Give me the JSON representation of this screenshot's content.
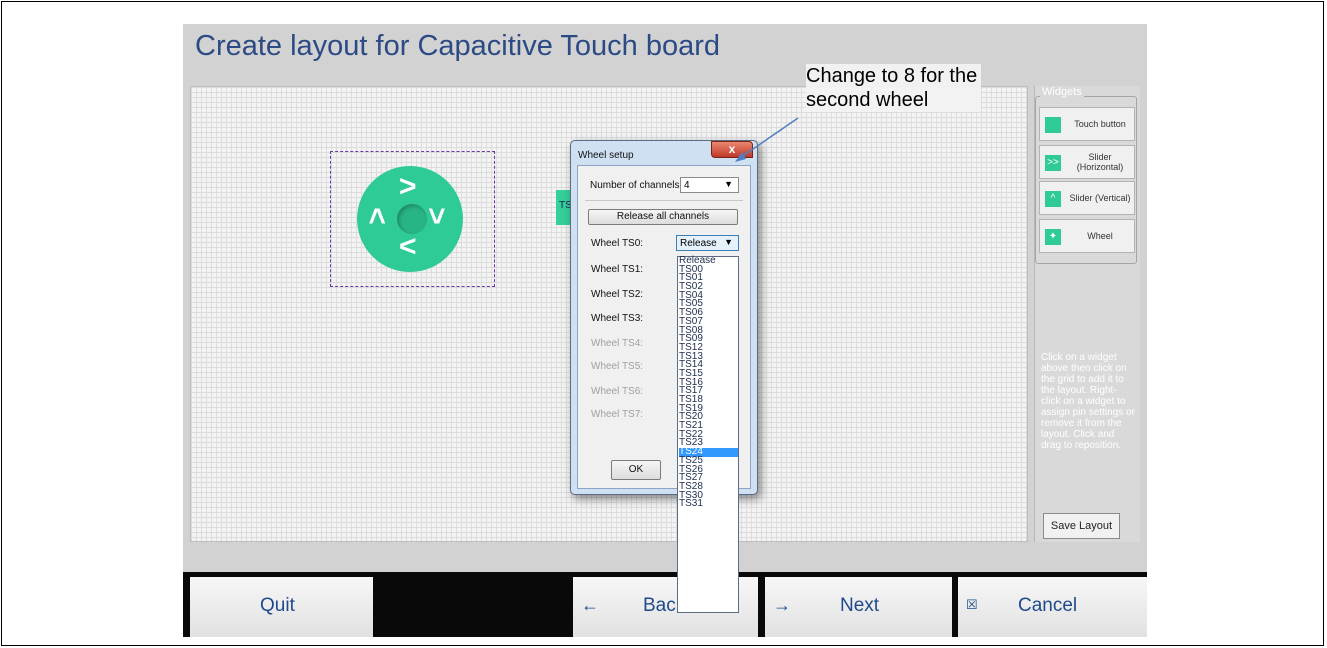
{
  "app": {
    "title": "Create layout for Capacitive Touch board"
  },
  "annotation": {
    "line1": "Change to 8 for the",
    "line2": "second wheel"
  },
  "canvas": {
    "chip_label": "TS"
  },
  "widgets": {
    "heading": "Widgets",
    "items": [
      {
        "label": "Touch button",
        "icon": "square-swatch-icon"
      },
      {
        "label": "Slider (Horizontal)",
        "icon": "horizontal-slider-icon"
      },
      {
        "label": "Slider (Vertical)",
        "icon": "vertical-slider-icon"
      },
      {
        "label": "Wheel",
        "icon": "wheel-icon"
      }
    ],
    "help": "Click on a widget above then click on the grid to add it to the layout. Right-click on a widget to assign pin settings or remove it from the layout. Click and drag to reposition.",
    "save_label": "Save Layout"
  },
  "footer": {
    "quit": "Quit",
    "back": "Back",
    "next": "Next",
    "cancel": "Cancel"
  },
  "dialog": {
    "title": "Wheel setup",
    "close": "x",
    "channels_label": "Number of channels",
    "channels_value": "4",
    "release_all": "Release all channels",
    "rows": [
      {
        "label": "Wheel TS0:",
        "enabled": true
      },
      {
        "label": "Wheel TS1:",
        "enabled": true
      },
      {
        "label": "Wheel TS2:",
        "enabled": true
      },
      {
        "label": "Wheel TS3:",
        "enabled": true
      },
      {
        "label": "Wheel TS4:",
        "enabled": false
      },
      {
        "label": "Wheel TS5:",
        "enabled": false
      },
      {
        "label": "Wheel TS6:",
        "enabled": false
      },
      {
        "label": "Wheel TS7:",
        "enabled": false
      }
    ],
    "ts0_value": "Release",
    "ok": "OK",
    "dropdown_options": [
      "Release",
      "TS00",
      "TS01",
      "TS02",
      "TS04",
      "TS05",
      "TS06",
      "TS07",
      "TS08",
      "TS09",
      "TS12",
      "TS13",
      "TS14",
      "TS15",
      "TS16",
      "TS17",
      "TS18",
      "TS19",
      "TS20",
      "TS21",
      "TS22",
      "TS23",
      "TS24",
      "TS25",
      "TS26",
      "TS27",
      "TS28",
      "TS30",
      "TS31"
    ],
    "dropdown_selected": "TS24"
  },
  "colors": {
    "accent": "#2fcb96",
    "title": "#2c4a84",
    "selection": "#3399ff"
  }
}
